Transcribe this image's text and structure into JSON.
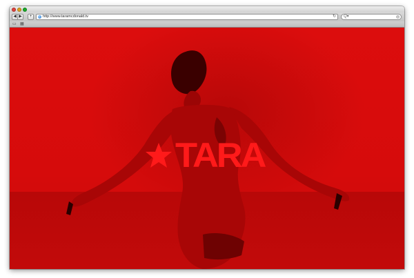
{
  "browser": {
    "url": "http://www.taramcdonald.tv",
    "search_placeholder": "",
    "nav_back": "◀",
    "nav_forward": "▶",
    "add": "+",
    "reload": "↻",
    "search_glyph": "Q▾",
    "search_clear": "×",
    "bookmark_reader": "▭",
    "bookmark_grid": "▦"
  },
  "page": {
    "logo_text": "TARA",
    "accent_color": "#ff1a1a",
    "background_color": "#d60b0b"
  },
  "icons": {
    "logo": "star-icon",
    "address": "globe-icon"
  }
}
